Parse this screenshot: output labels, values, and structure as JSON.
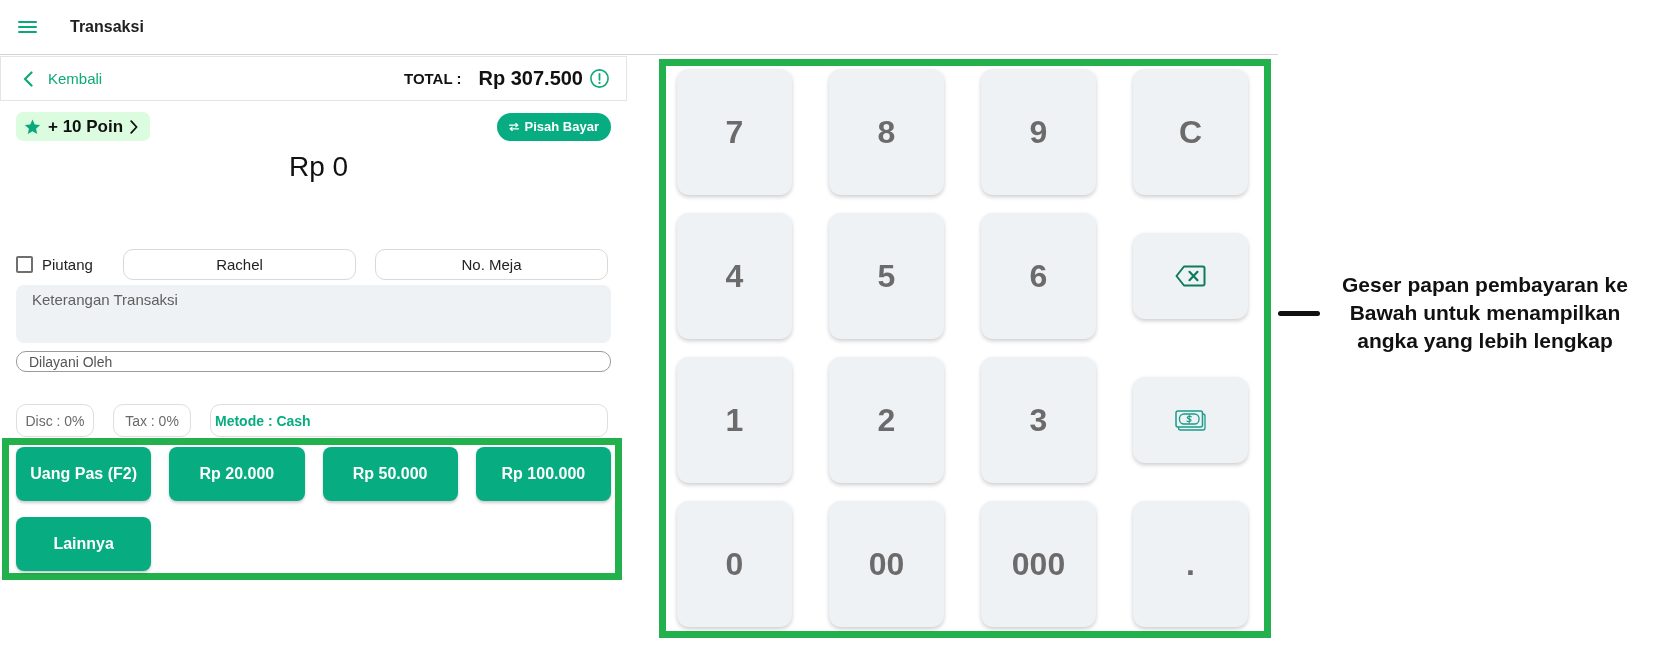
{
  "header": {
    "title": "Transaksi"
  },
  "summary_bar": {
    "back_label": "Kembali",
    "total_label": "TOTAL :",
    "total_value": "Rp 307.500"
  },
  "points_button": {
    "label": "+ 10 Poin"
  },
  "split_button": {
    "label": "Pisah Bayar"
  },
  "amount_display": "Rp 0",
  "debt_checkbox": {
    "label": "Piutang",
    "checked": false
  },
  "customer_button": {
    "label": "Rachel"
  },
  "table_button": {
    "label": "No. Meja"
  },
  "note_field": {
    "placeholder": "Keterangan Transaksi"
  },
  "served_by_field": {
    "placeholder": "Dilayani Oleh"
  },
  "chips": [
    {
      "kind": "discount",
      "label": "Disc : 0%"
    },
    {
      "kind": "tax",
      "label": "Tax : 0%"
    },
    {
      "kind": "method",
      "label": "Metode : Cash"
    }
  ],
  "quick_cash_buttons": [
    "Uang Pas (F2)",
    "Rp 20.000",
    "Rp 50.000",
    "Rp 100.000",
    "Lainnya"
  ],
  "keypad": [
    {
      "kind": "digit",
      "label": "7"
    },
    {
      "kind": "digit",
      "label": "8"
    },
    {
      "kind": "digit",
      "label": "9"
    },
    {
      "kind": "clear",
      "label": "C"
    },
    {
      "kind": "digit",
      "label": "4"
    },
    {
      "kind": "digit",
      "label": "5"
    },
    {
      "kind": "digit",
      "label": "6"
    },
    {
      "kind": "backspace"
    },
    {
      "kind": "digit",
      "label": "1"
    },
    {
      "kind": "digit",
      "label": "2"
    },
    {
      "kind": "digit",
      "label": "3"
    },
    {
      "kind": "cash"
    },
    {
      "kind": "digit",
      "label": "0"
    },
    {
      "kind": "digit",
      "label": "00"
    },
    {
      "kind": "digit",
      "label": "000"
    },
    {
      "kind": "decimal",
      "label": "."
    }
  ],
  "callout": {
    "text": "Geser papan pembayaran ke Bawah untuk menampilkan angka yang lebih lengkap"
  }
}
